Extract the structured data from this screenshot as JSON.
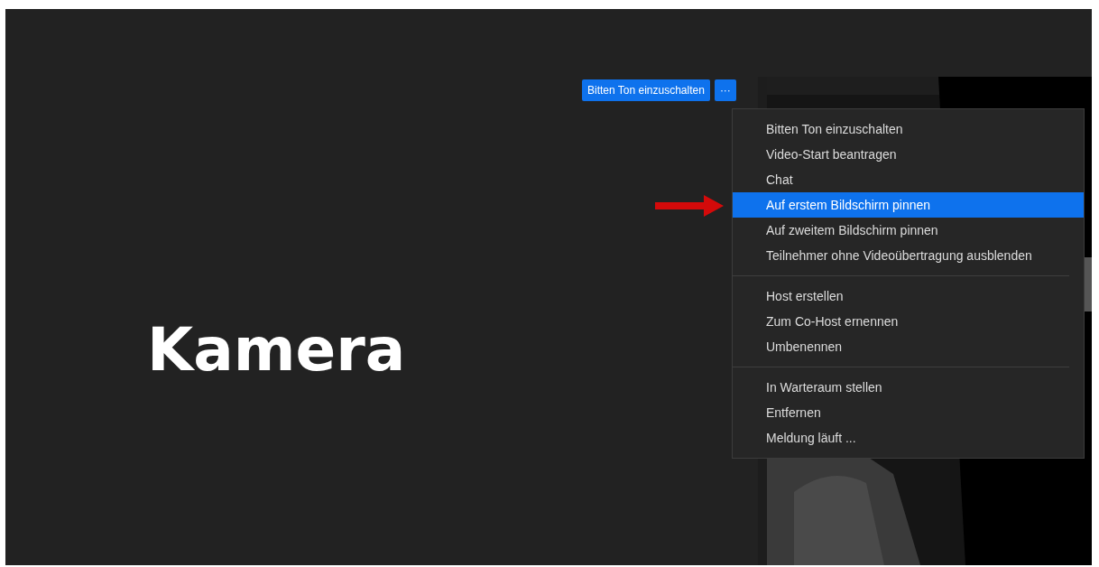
{
  "video_tile": {
    "name": "Kamera"
  },
  "toolbar": {
    "ask_button": "Bitten Ton einzuschalten",
    "more_button": "···"
  },
  "menu": {
    "groups": [
      [
        {
          "label": "Bitten Ton einzuschalten",
          "selected": false
        },
        {
          "label": "Video-Start beantragen",
          "selected": false
        },
        {
          "label": "Chat",
          "selected": false
        },
        {
          "label": "Auf erstem Bildschirm pinnen",
          "selected": true
        },
        {
          "label": "Auf zweitem Bildschirm pinnen",
          "selected": false
        },
        {
          "label": "Teilnehmer ohne Videoübertragung ausblenden",
          "selected": false
        }
      ],
      [
        {
          "label": "Host erstellen",
          "selected": false
        },
        {
          "label": "Zum Co-Host ernennen",
          "selected": false
        },
        {
          "label": "Umbenennen",
          "selected": false
        }
      ],
      [
        {
          "label": "In Warteraum stellen",
          "selected": false
        },
        {
          "label": "Entfernen",
          "selected": false
        },
        {
          "label": "Meldung läuft ...",
          "selected": false
        }
      ]
    ]
  }
}
